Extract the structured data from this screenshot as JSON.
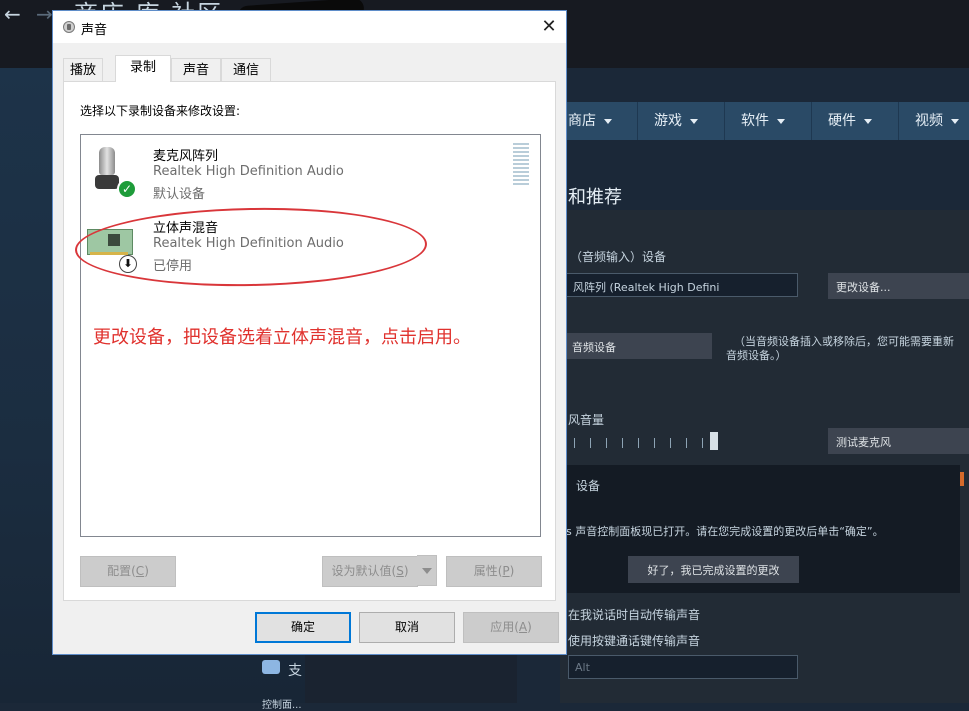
{
  "steam": {
    "nav_back": "←",
    "nav_forward": "→",
    "top_nav": "商店  库  社区",
    "store_nav": [
      {
        "label": "商店"
      },
      {
        "label": "游戏"
      },
      {
        "label": "软件"
      },
      {
        "label": "硬件"
      },
      {
        "label": "视频"
      }
    ],
    "section_title": "和推荐",
    "input_device_label": "（音频输入）设备",
    "input_device_value": "风阵列 (Realtek High Defini",
    "change_device_button": "更改设备...",
    "audio_device_button": "音频设备",
    "hint_text_1": "（当音频设备插入或移除后，您可能需要重新",
    "hint_text_2": "音频设备。）",
    "mic_volume_label": "风音量",
    "test_mic_button": "测试麦克风",
    "device_label": "设备",
    "control_panel_text": "s 声音控制面板现已打开。请在您完成设置的更改后单击“确定”。",
    "done_button": "好了，我已完成设置的更改",
    "auto_transmit": "在我说话时自动传输声音",
    "push_to_talk": "使用按键通话键传输声音",
    "key_field_value": "Alt",
    "left_partial": "支",
    "left_partial_2": "控制面..."
  },
  "dialog": {
    "title": "声音",
    "close_glyph": "✕",
    "tabs": [
      {
        "label": "播放"
      },
      {
        "label": "录制"
      },
      {
        "label": "声音"
      },
      {
        "label": "通信"
      }
    ],
    "active_tab": "录制",
    "instruction": "选择以下录制设备来修改设置:",
    "devices": [
      {
        "name": "麦克风阵列",
        "driver": "Realtek High Definition Audio",
        "status": "默认设备",
        "icon": "microphone-icon",
        "badge": "default-check-icon"
      },
      {
        "name": "立体声混音",
        "driver": "Realtek High Definition Audio",
        "status": "已停用",
        "icon": "sound-card-icon",
        "badge": "disabled-arrow-icon"
      }
    ],
    "annotation": "更改设备，把设备选着立体声混音，点击启用。",
    "annotation_color": "#e0322e",
    "buttons": {
      "configure": {
        "text": "配置(",
        "key": "C",
        "tail": ")"
      },
      "set_default": {
        "text": "设为默认值(",
        "key": "S",
        "tail": ")"
      },
      "properties": {
        "text": "属性(",
        "key": "P",
        "tail": ")"
      },
      "ok": "确定",
      "cancel": "取消",
      "apply": {
        "text": "应用(",
        "key": "A",
        "tail": ")"
      }
    }
  }
}
